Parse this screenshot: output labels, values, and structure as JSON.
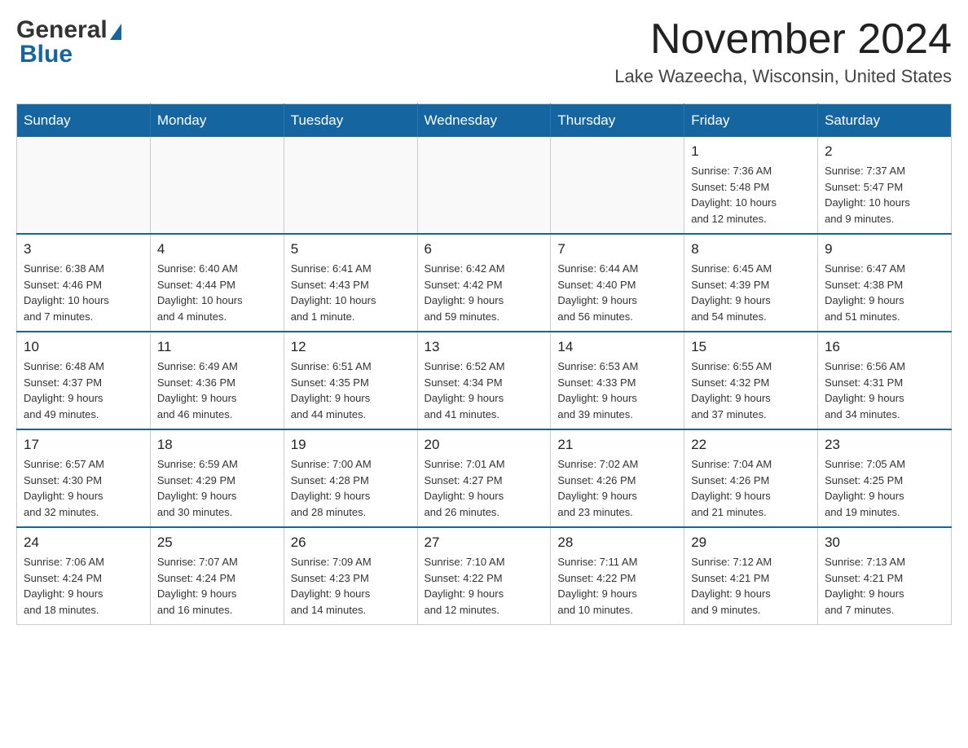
{
  "header": {
    "logo_general": "General",
    "logo_blue": "Blue",
    "month_title": "November 2024",
    "location": "Lake Wazeecha, Wisconsin, United States"
  },
  "weekdays": [
    "Sunday",
    "Monday",
    "Tuesday",
    "Wednesday",
    "Thursday",
    "Friday",
    "Saturday"
  ],
  "weeks": [
    {
      "days": [
        {
          "number": "",
          "info": ""
        },
        {
          "number": "",
          "info": ""
        },
        {
          "number": "",
          "info": ""
        },
        {
          "number": "",
          "info": ""
        },
        {
          "number": "",
          "info": ""
        },
        {
          "number": "1",
          "info": "Sunrise: 7:36 AM\nSunset: 5:48 PM\nDaylight: 10 hours\nand 12 minutes."
        },
        {
          "number": "2",
          "info": "Sunrise: 7:37 AM\nSunset: 5:47 PM\nDaylight: 10 hours\nand 9 minutes."
        }
      ]
    },
    {
      "days": [
        {
          "number": "3",
          "info": "Sunrise: 6:38 AM\nSunset: 4:46 PM\nDaylight: 10 hours\nand 7 minutes."
        },
        {
          "number": "4",
          "info": "Sunrise: 6:40 AM\nSunset: 4:44 PM\nDaylight: 10 hours\nand 4 minutes."
        },
        {
          "number": "5",
          "info": "Sunrise: 6:41 AM\nSunset: 4:43 PM\nDaylight: 10 hours\nand 1 minute."
        },
        {
          "number": "6",
          "info": "Sunrise: 6:42 AM\nSunset: 4:42 PM\nDaylight: 9 hours\nand 59 minutes."
        },
        {
          "number": "7",
          "info": "Sunrise: 6:44 AM\nSunset: 4:40 PM\nDaylight: 9 hours\nand 56 minutes."
        },
        {
          "number": "8",
          "info": "Sunrise: 6:45 AM\nSunset: 4:39 PM\nDaylight: 9 hours\nand 54 minutes."
        },
        {
          "number": "9",
          "info": "Sunrise: 6:47 AM\nSunset: 4:38 PM\nDaylight: 9 hours\nand 51 minutes."
        }
      ]
    },
    {
      "days": [
        {
          "number": "10",
          "info": "Sunrise: 6:48 AM\nSunset: 4:37 PM\nDaylight: 9 hours\nand 49 minutes."
        },
        {
          "number": "11",
          "info": "Sunrise: 6:49 AM\nSunset: 4:36 PM\nDaylight: 9 hours\nand 46 minutes."
        },
        {
          "number": "12",
          "info": "Sunrise: 6:51 AM\nSunset: 4:35 PM\nDaylight: 9 hours\nand 44 minutes."
        },
        {
          "number": "13",
          "info": "Sunrise: 6:52 AM\nSunset: 4:34 PM\nDaylight: 9 hours\nand 41 minutes."
        },
        {
          "number": "14",
          "info": "Sunrise: 6:53 AM\nSunset: 4:33 PM\nDaylight: 9 hours\nand 39 minutes."
        },
        {
          "number": "15",
          "info": "Sunrise: 6:55 AM\nSunset: 4:32 PM\nDaylight: 9 hours\nand 37 minutes."
        },
        {
          "number": "16",
          "info": "Sunrise: 6:56 AM\nSunset: 4:31 PM\nDaylight: 9 hours\nand 34 minutes."
        }
      ]
    },
    {
      "days": [
        {
          "number": "17",
          "info": "Sunrise: 6:57 AM\nSunset: 4:30 PM\nDaylight: 9 hours\nand 32 minutes."
        },
        {
          "number": "18",
          "info": "Sunrise: 6:59 AM\nSunset: 4:29 PM\nDaylight: 9 hours\nand 30 minutes."
        },
        {
          "number": "19",
          "info": "Sunrise: 7:00 AM\nSunset: 4:28 PM\nDaylight: 9 hours\nand 28 minutes."
        },
        {
          "number": "20",
          "info": "Sunrise: 7:01 AM\nSunset: 4:27 PM\nDaylight: 9 hours\nand 26 minutes."
        },
        {
          "number": "21",
          "info": "Sunrise: 7:02 AM\nSunset: 4:26 PM\nDaylight: 9 hours\nand 23 minutes."
        },
        {
          "number": "22",
          "info": "Sunrise: 7:04 AM\nSunset: 4:26 PM\nDaylight: 9 hours\nand 21 minutes."
        },
        {
          "number": "23",
          "info": "Sunrise: 7:05 AM\nSunset: 4:25 PM\nDaylight: 9 hours\nand 19 minutes."
        }
      ]
    },
    {
      "days": [
        {
          "number": "24",
          "info": "Sunrise: 7:06 AM\nSunset: 4:24 PM\nDaylight: 9 hours\nand 18 minutes."
        },
        {
          "number": "25",
          "info": "Sunrise: 7:07 AM\nSunset: 4:24 PM\nDaylight: 9 hours\nand 16 minutes."
        },
        {
          "number": "26",
          "info": "Sunrise: 7:09 AM\nSunset: 4:23 PM\nDaylight: 9 hours\nand 14 minutes."
        },
        {
          "number": "27",
          "info": "Sunrise: 7:10 AM\nSunset: 4:22 PM\nDaylight: 9 hours\nand 12 minutes."
        },
        {
          "number": "28",
          "info": "Sunrise: 7:11 AM\nSunset: 4:22 PM\nDaylight: 9 hours\nand 10 minutes."
        },
        {
          "number": "29",
          "info": "Sunrise: 7:12 AM\nSunset: 4:21 PM\nDaylight: 9 hours\nand 9 minutes."
        },
        {
          "number": "30",
          "info": "Sunrise: 7:13 AM\nSunset: 4:21 PM\nDaylight: 9 hours\nand 7 minutes."
        }
      ]
    }
  ]
}
